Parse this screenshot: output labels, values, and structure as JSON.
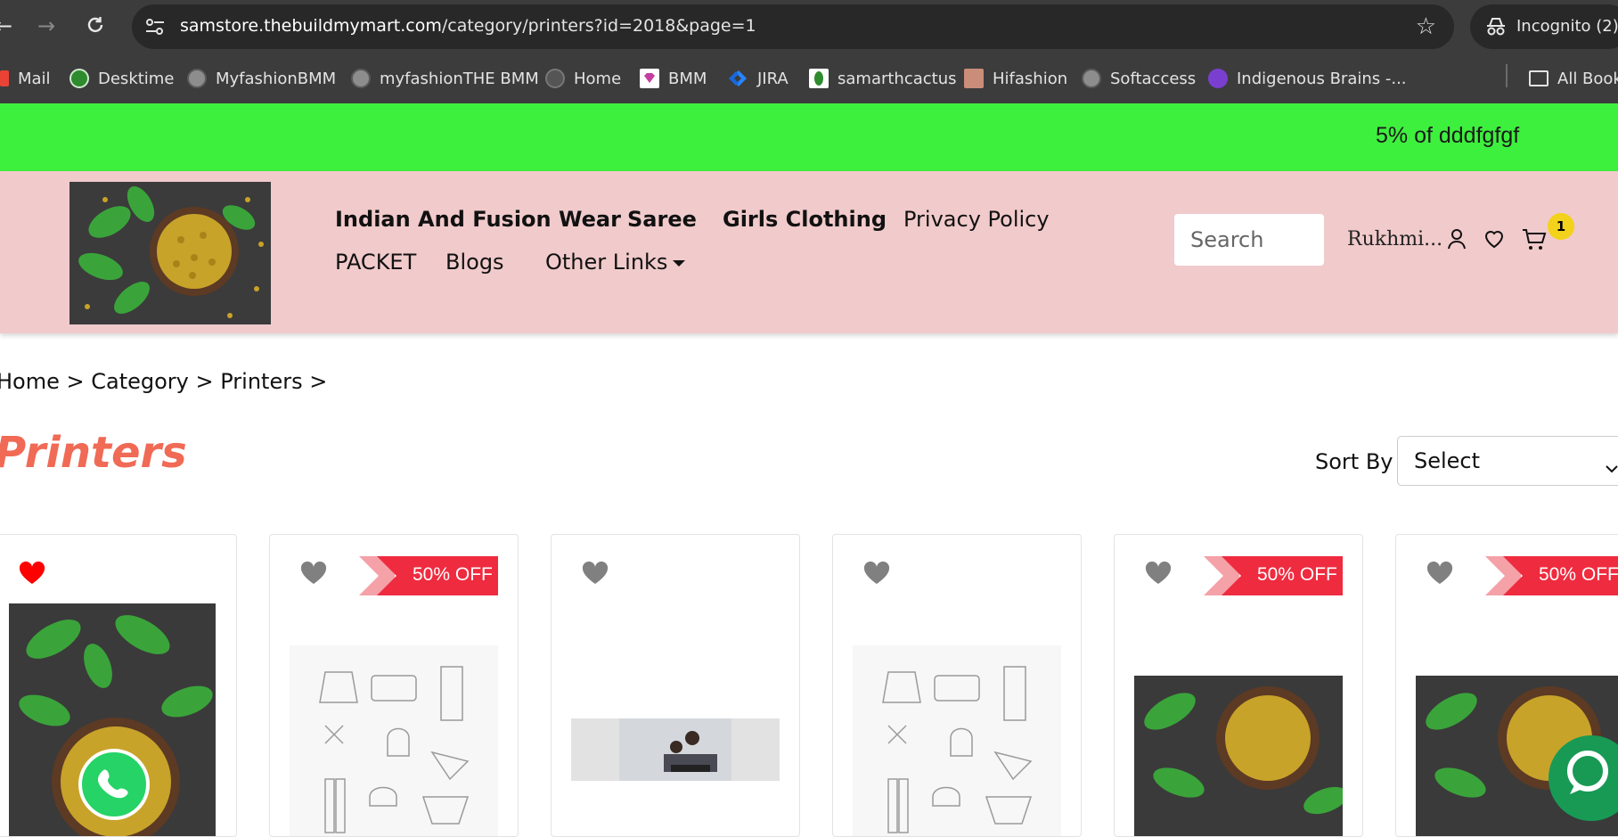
{
  "browser": {
    "url_domain": "samstore.thebuildmymart.com",
    "url_path": "/category/printers?id=2018&page=1",
    "incognito_label": "Incognito (2)",
    "bookmarks": [
      "Mail",
      "Desktime",
      "MyfashionBMM",
      "myfashionTHE BMM",
      "Home",
      "BMM",
      "JIRA",
      "samarthcactus",
      "Hifashion",
      "Softaccess",
      "Indigenous Brains -...",
      "All Book"
    ]
  },
  "promo": {
    "text": "5% of dddfgfgf"
  },
  "header": {
    "nav_primary": [
      "Indian And Fusion Wear",
      "Saree",
      "Girls Clothing"
    ],
    "nav_secondary": [
      "Privacy Policy",
      "PACKET",
      "Blogs",
      "Other Links"
    ],
    "search_placeholder": "Search",
    "user_name": "Rukhmi...",
    "cart_count": "1"
  },
  "breadcrumb": {
    "text": "Home > Category > Printers >"
  },
  "page": {
    "title": "Printers",
    "sort_label": "Sort By",
    "sort_value": "Select"
  },
  "products": [
    {
      "badge": "",
      "wishlisted": true,
      "image": "fenugreek-photo"
    },
    {
      "badge": "50% OFF",
      "wishlisted": false,
      "image": "line-art-placeholder"
    },
    {
      "badge": "",
      "wishlisted": false,
      "image": "office-photo"
    },
    {
      "badge": "",
      "wishlisted": false,
      "image": "line-art-placeholder"
    },
    {
      "badge": "50% OFF",
      "wishlisted": false,
      "image": "fenugreek-photo"
    },
    {
      "badge": "50% OFF",
      "wishlisted": false,
      "image": "fenugreek-photo"
    }
  ],
  "colors": {
    "promo_bg": "#3ef03e",
    "header_bg": "#f1cacb",
    "title": "#f06a55",
    "badge_red": "#ef2b3f",
    "heart_active": "#ff0000",
    "heart_inactive": "#808080"
  }
}
